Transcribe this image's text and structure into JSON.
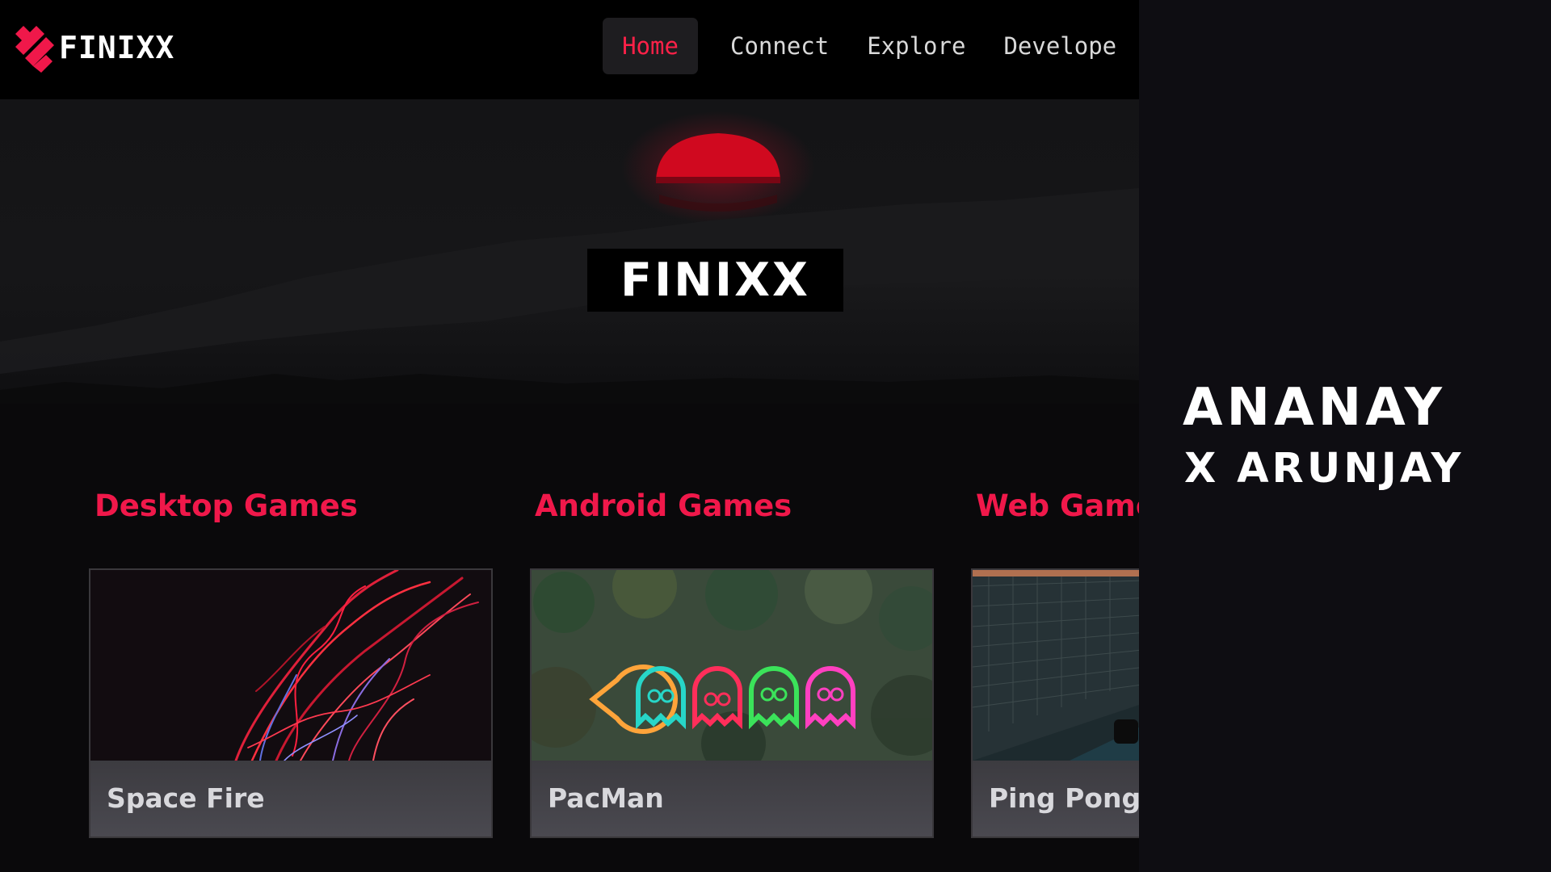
{
  "navbar": {
    "logo_text": "FINIXX",
    "items": [
      {
        "label": "Home",
        "active": true
      },
      {
        "label": "Connect",
        "active": false
      },
      {
        "label": "Explore",
        "active": false
      },
      {
        "label": "Develope",
        "active": false
      }
    ]
  },
  "hero": {
    "title": "FINIXX"
  },
  "categories": [
    {
      "title": "Desktop Games",
      "game": "Space Fire"
    },
    {
      "title": "Android Games",
      "game": "PacMan"
    },
    {
      "title": "Web Game",
      "game": "Ping Pong"
    }
  ],
  "brand": {
    "line1": "ANANAY",
    "line2": "X ARUNJAY"
  },
  "colors": {
    "accent": "#ff2148",
    "category": "#f0184a",
    "navbar": "#000000",
    "background": "#0a090b"
  }
}
